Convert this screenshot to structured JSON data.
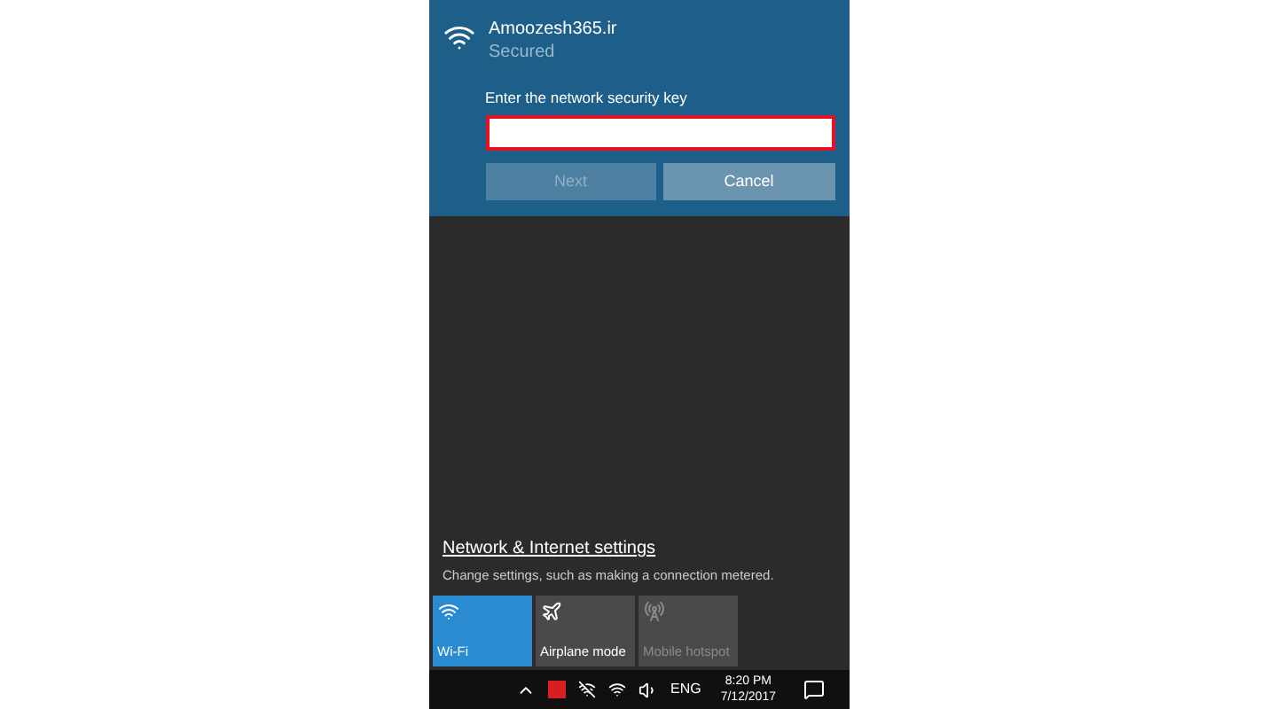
{
  "network": {
    "name": "Amoozesh365.ir",
    "status": "Secured"
  },
  "key_prompt": {
    "label": "Enter the network security key"
  },
  "buttons": [
    {
      "label": "Next",
      "disabled": true
    },
    {
      "label": "Cancel",
      "disabled": false
    }
  ],
  "settings": {
    "link": "Network & Internet settings",
    "description": "Change settings, such as making a connection metered."
  },
  "tiles": [
    {
      "kind": "wifi",
      "label": "Wi-Fi",
      "on": true,
      "disabled": false
    },
    {
      "kind": "airplane",
      "label": "Airplane mode",
      "on": false,
      "disabled": false
    },
    {
      "kind": "hotspot",
      "label": "Mobile hotspot",
      "on": false,
      "disabled": true
    }
  ],
  "taskbar": {
    "language": "ENG",
    "time": "8:20 PM",
    "date": "7/12/2017"
  }
}
